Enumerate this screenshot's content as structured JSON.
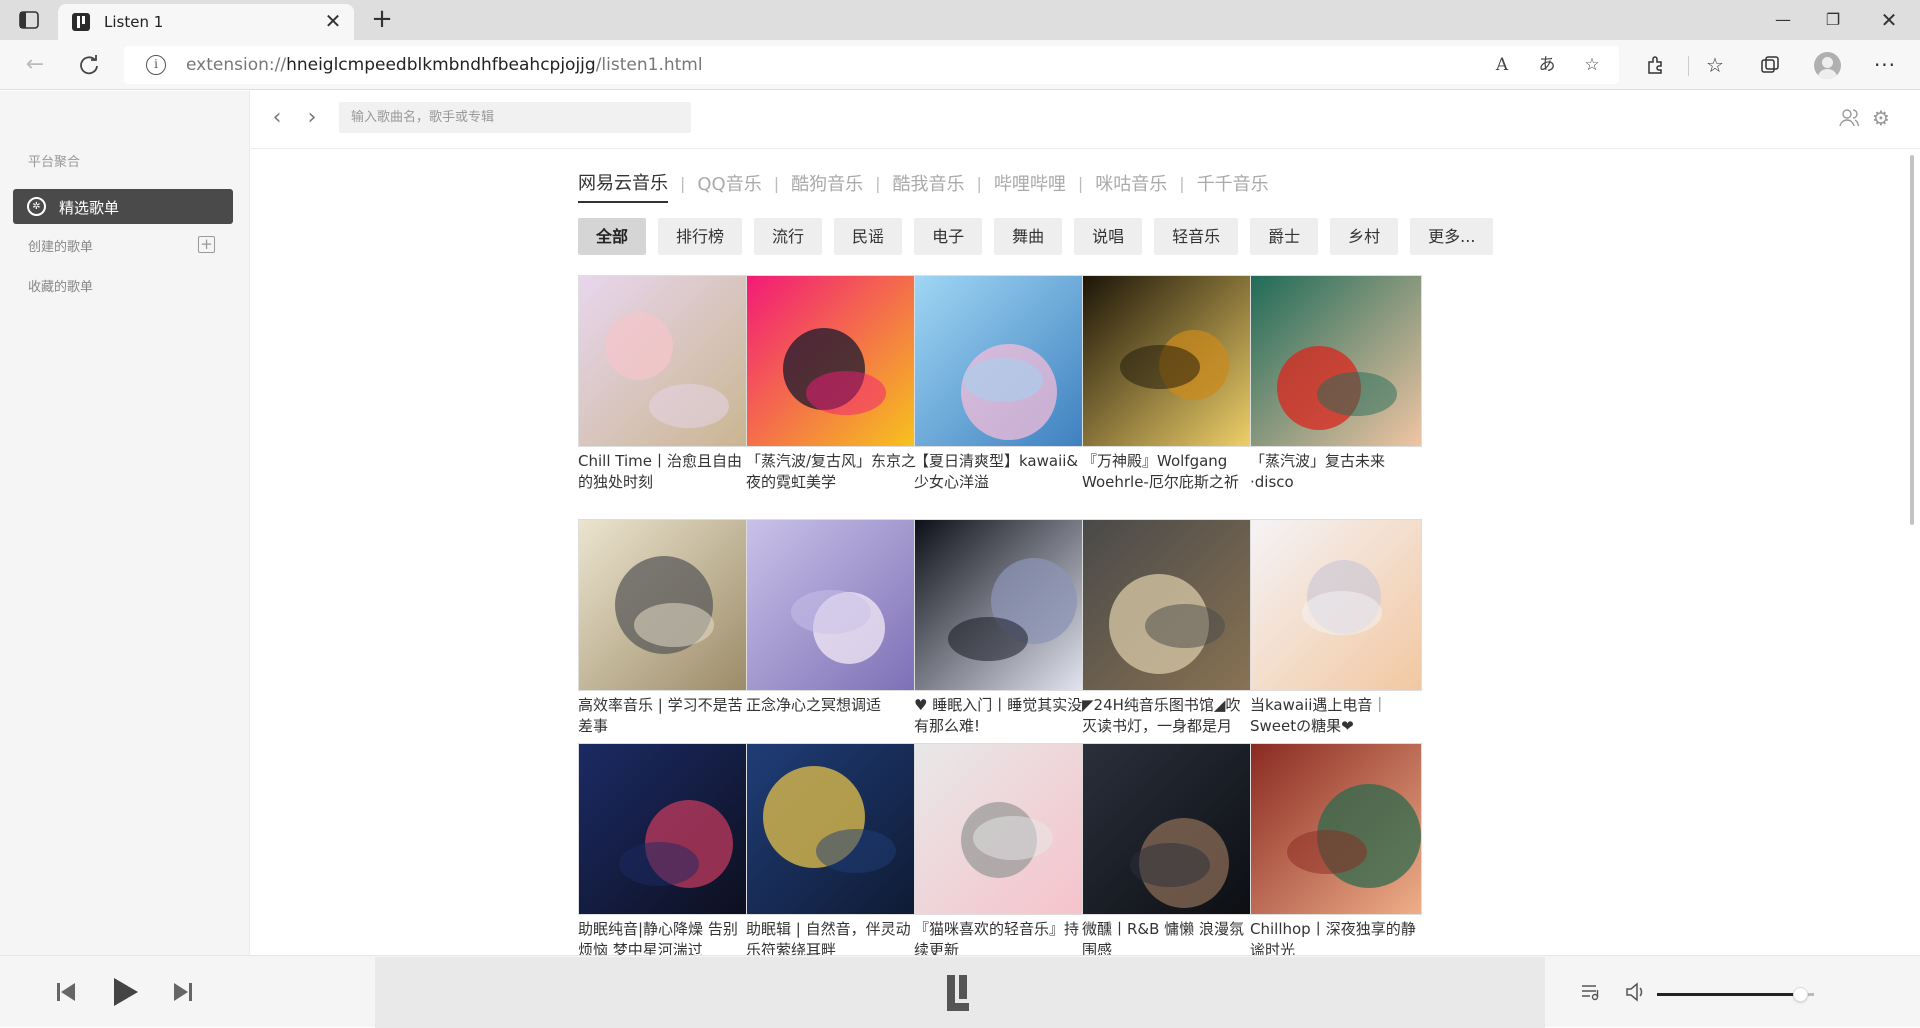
{
  "browser": {
    "tab_title": "Listen 1",
    "url_prefix": "extension://",
    "url_host": "hneiglcmpeedblkmbndhfbeahcpjojjg",
    "url_path": "/listen1.html",
    "tab_close": "✕",
    "new_tab": "+",
    "read_aloud_icon": "A",
    "translate_icon": "あ"
  },
  "sidebar": {
    "section_title": "平台聚合",
    "active_item": "精选歌单",
    "created_playlists": "创建的歌单",
    "collected_playlists": "收藏的歌单"
  },
  "topnav": {
    "search_placeholder": "输入歌曲名，歌手或专辑"
  },
  "sources": [
    "网易云音乐",
    "QQ音乐",
    "酷狗音乐",
    "酷我音乐",
    "哔哩哔哩",
    "咪咕音乐",
    "千千音乐"
  ],
  "filters": [
    "全部",
    "排行榜",
    "流行",
    "民谣",
    "电子",
    "舞曲",
    "说唱",
    "轻音乐",
    "爵士",
    "乡村",
    "更多..."
  ],
  "playlists": [
    {
      "title": "Chill Time丨治愈且自由的独处时刻",
      "palette": [
        "#e8d6ee",
        "#f4c6c9",
        "#c9b58f"
      ]
    },
    {
      "title": "「蒸汽波/复古风」东京之夜的霓虹美学",
      "palette": [
        "#f21a78",
        "#1a1a2e",
        "#f6c61b"
      ]
    },
    {
      "title": "【夏日清爽型】kawaii&少女心洋溢",
      "palette": [
        "#9fd6f4",
        "#f3bcd8",
        "#3d7fbf"
      ]
    },
    {
      "title": "『万神殿』Wolfgang Woehrle-厄尔庇斯之祈",
      "palette": [
        "#1c1508",
        "#c9891e",
        "#f3d36b"
      ]
    },
    {
      "title": "「蒸汽波」复古未来·disco",
      "palette": [
        "#1f6b58",
        "#d9261d",
        "#f2c6a4"
      ]
    },
    {
      "title": "高效率音乐 | 学习不是苦差事",
      "palette": [
        "#ece4cf",
        "#5b5b5b",
        "#9a8a66"
      ]
    },
    {
      "title": "正念净心之冥想调适",
      "palette": [
        "#c9c1e9",
        "#f3e9f5",
        "#7c6fb5"
      ]
    },
    {
      "title": "♥ 睡眠入门丨睡觉其实没有那么难!",
      "palette": [
        "#0e1019",
        "#8c94b5",
        "#e6e9f5"
      ]
    },
    {
      "title": "◤24H纯音乐图书馆◢吹灭读书灯，一身都是月",
      "palette": [
        "#494949",
        "#d8c9a7",
        "#8a7353"
      ]
    },
    {
      "title": "当kawaii遇上电音｜Sweetの糖果❤",
      "palette": [
        "#f5f3f6",
        "#d0cbd6",
        "#f2c7a0"
      ]
    },
    {
      "title": "助眠纯音|静心降燥 告别烦恼 梦中星河湍过",
      "palette": [
        "#1b2a64",
        "#c0395c",
        "#0d0f1e"
      ]
    },
    {
      "title": "助眠辑 | 自然音，伴灵动乐符萦绕耳畔",
      "palette": [
        "#1f3d77",
        "#e5c14a",
        "#0f1a33"
      ]
    },
    {
      "title": "『猫咪喜欢的轻音乐』持续更新",
      "palette": [
        "#e8e8e8",
        "#9b9b9b",
        "#f6c2ca"
      ]
    },
    {
      "title": "微醺丨R&B 慵懒 浪漫氛围感",
      "palette": [
        "#2a2f3b",
        "#8a6b56",
        "#0c0e12"
      ]
    },
    {
      "title": "Chillhop丨深夜独享的静谧时光",
      "palette": [
        "#8a2a22",
        "#2e6a4d",
        "#f0b08a"
      ]
    }
  ],
  "player": {
    "volume_level": 0.88
  }
}
